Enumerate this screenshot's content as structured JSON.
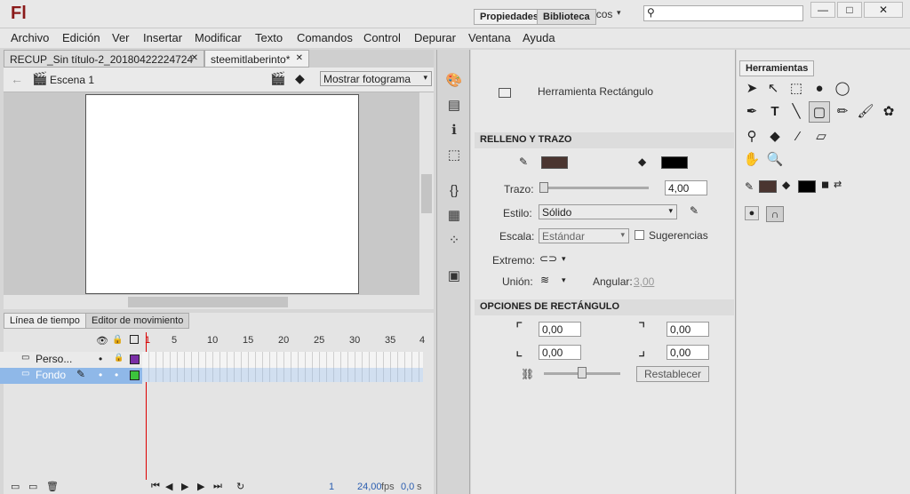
{
  "app": {
    "logo": "Fl",
    "workspace": "Conceptos básicos",
    "workspace_arrow": "▾",
    "search_icon": "⚲"
  },
  "window": {
    "min": "—",
    "max": "□",
    "close": "✕"
  },
  "menu": [
    "Archivo",
    "Edición",
    "Ver",
    "Insertar",
    "Modificar",
    "Texto",
    "Comandos",
    "Control",
    "Depurar",
    "Ventana",
    "Ayuda"
  ],
  "doc_tabs": [
    {
      "label": "RECUP_Sin título-2_20180422224724",
      "close": "✕"
    },
    {
      "label": "steemitlaberinto*",
      "close": "✕"
    }
  ],
  "edit_bar": {
    "scene": "Escena 1",
    "zoom": "Mostrar fotograma"
  },
  "timeline": {
    "tabs": [
      "Línea de tiempo",
      "Editor de movimiento"
    ],
    "ruler": [
      "1",
      "5",
      "10",
      "15",
      "20",
      "25",
      "30",
      "35",
      "4"
    ],
    "layers": [
      {
        "name": "Perso...",
        "color": "#7a2ea6",
        "selected": false
      },
      {
        "name": "Fondo",
        "color": "#3cc43c",
        "selected": true
      }
    ],
    "fps": "24,00",
    "fps_unit": "fps",
    "frame": "1",
    "time": "0,0",
    "time_unit": "s"
  },
  "props": {
    "tabs": [
      "Propiedades",
      "Biblioteca"
    ],
    "tool_name": "Herramienta Rectángulo",
    "section_fill": "RELLENO Y TRAZO",
    "stroke_color": "#4a3530",
    "fill_color": "#000000",
    "trazo_label": "Trazo:",
    "trazo_value": "4,00",
    "estilo_label": "Estilo:",
    "estilo_value": "Sólido",
    "escala_label": "Escala:",
    "escala_value": "Estándar",
    "sugerencias": "Sugerencias",
    "extremo_label": "Extremo:",
    "union_label": "Unión:",
    "angular_label": "Angular:",
    "angular_value": "3,00",
    "section_rect": "OPCIONES DE RECTÁNGULO",
    "corners": [
      "0,00",
      "0,00",
      "0,00",
      "0,00"
    ],
    "reset": "Restablecer"
  },
  "tools": {
    "title": "Herramientas",
    "stroke_color": "#4a3530",
    "fill_color": "#000000"
  }
}
